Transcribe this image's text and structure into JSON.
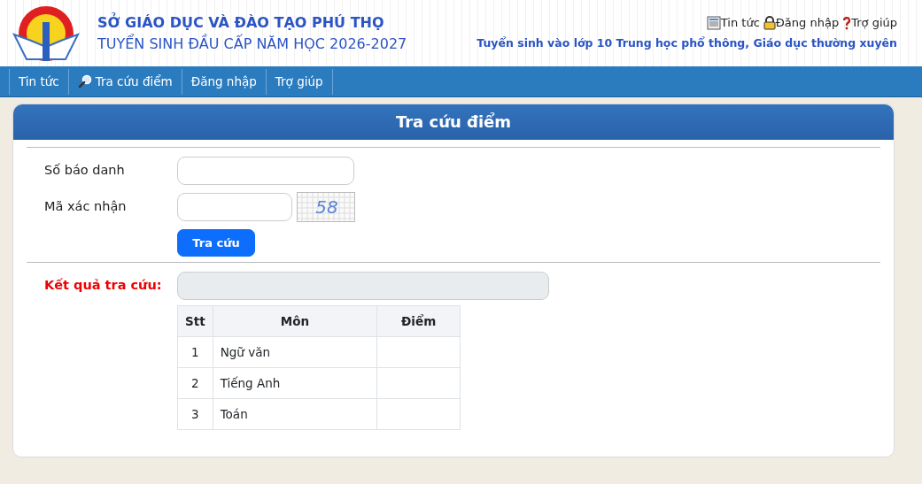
{
  "header": {
    "title": "SỞ GIÁO DỤC VÀ ĐÀO TẠO PHÚ THỌ",
    "subtitle": "TUYỂN SINH ĐẦU CẤP NĂM HỌC 2026-2027",
    "tagline": "Tuyển sinh vào lớp 10 Trung học phổ thông, Giáo dục thường xuyên"
  },
  "top_links": [
    "Tin tức",
    "Đăng nhập",
    "Trợ giúp"
  ],
  "nav": [
    "Tin tức",
    "Tra cứu điểm",
    "Đăng nhập",
    "Trợ giúp"
  ],
  "panel": {
    "title": "Tra cứu điểm",
    "fields": [
      {
        "label": "Số báo danh",
        "kind": "text"
      },
      {
        "label": "Mã xác nhận",
        "kind": "captcha",
        "captcha": "58"
      }
    ],
    "submit": "Tra cứu",
    "result_label": "Kết quả tra cứu:",
    "table": {
      "columns": [
        "Stt",
        "Môn",
        "Điểm"
      ],
      "rows": [
        [
          "1",
          "Ngữ văn"
        ],
        [
          "2",
          "Tiếng Anh"
        ],
        [
          "3",
          "Toán"
        ]
      ]
    }
  }
}
